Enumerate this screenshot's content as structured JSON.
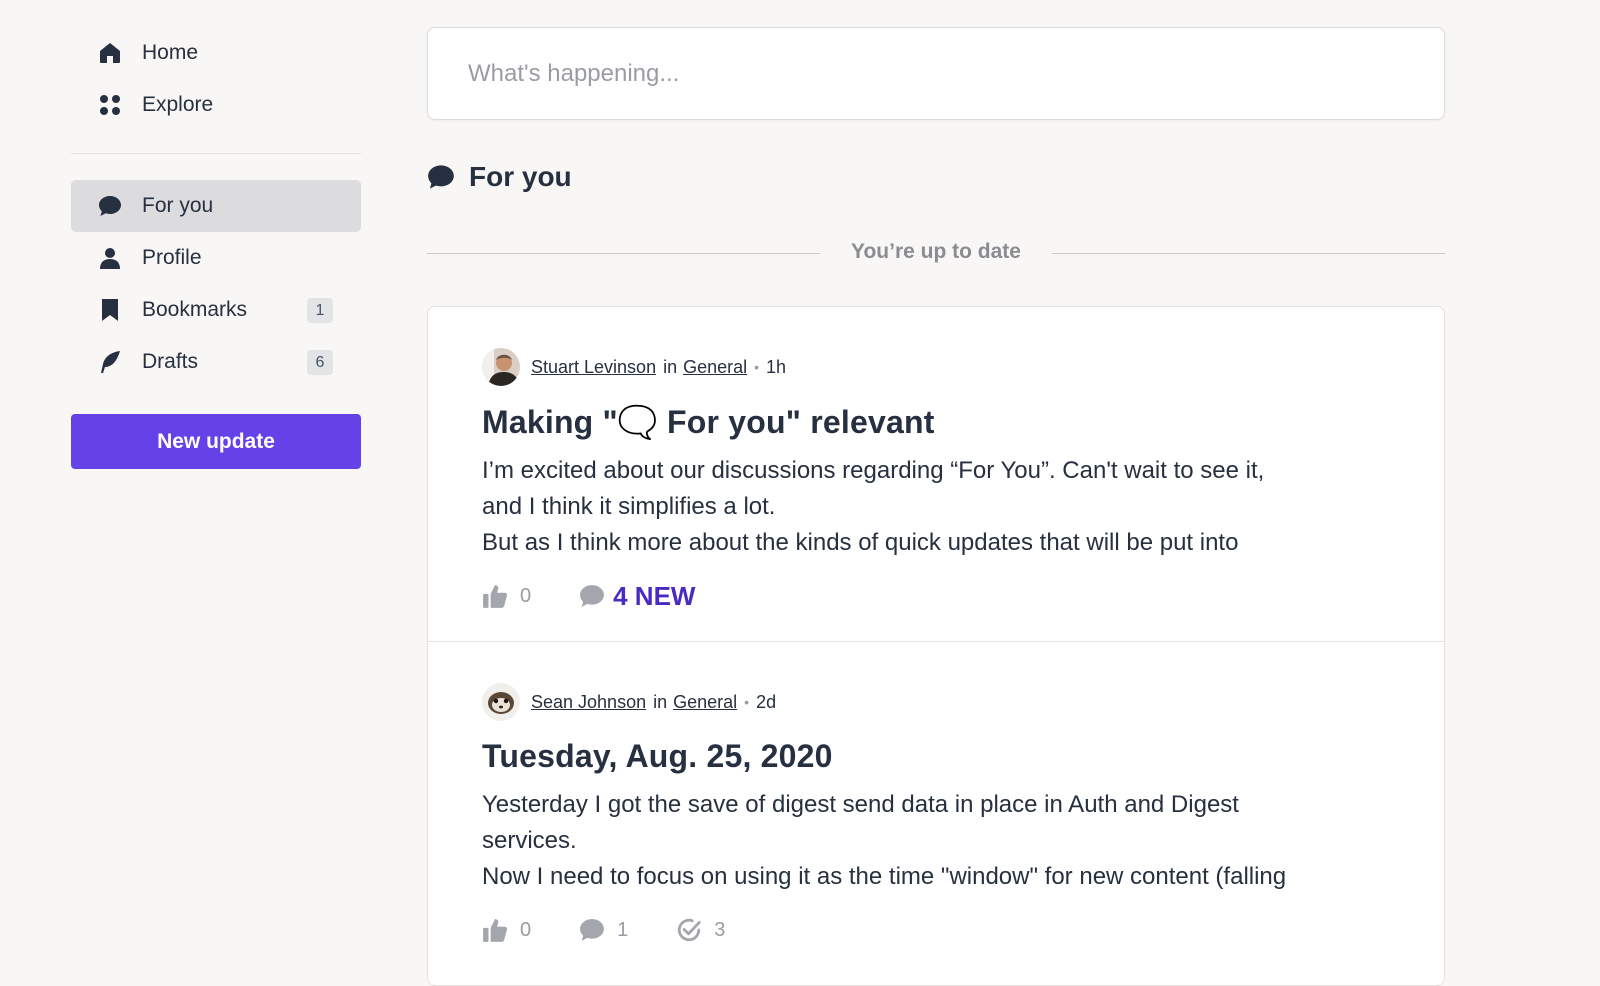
{
  "sidebar": {
    "top_items": [
      {
        "label": "Home",
        "icon": "home-icon"
      },
      {
        "label": "Explore",
        "icon": "explore-grid-icon"
      }
    ],
    "items": [
      {
        "label": "For you",
        "icon": "speech-bubble-icon",
        "active": true
      },
      {
        "label": "Profile",
        "icon": "person-icon"
      },
      {
        "label": "Bookmarks",
        "icon": "bookmark-icon",
        "badge": "1"
      },
      {
        "label": "Drafts",
        "icon": "quill-icon",
        "badge": "6"
      }
    ],
    "new_update_label": "New update"
  },
  "composer": {
    "placeholder": "What's happening..."
  },
  "feed": {
    "title": "For you",
    "status": "You’re up to date",
    "posts": [
      {
        "author": "Stuart Levinson",
        "in_label": "in",
        "group": "General",
        "time": "1h",
        "title": "Making \"🗨️ For you\" relevant",
        "body_lines": [
          "I’m excited about our discussions regarding “For You”. Can't wait to see it,",
          "and I think it simplifies a lot.",
          "But as I think more about the kinds of quick updates that will be put into"
        ],
        "likes": "0",
        "comments_new": "4 NEW"
      },
      {
        "author": "Sean Johnson",
        "in_label": "in",
        "group": "General",
        "time": "2d",
        "title": "Tuesday, Aug. 25, 2020",
        "body_lines": [
          "Yesterday I got the save of digest send data in place in Auth and Digest",
          "services.",
          "Now I need to focus on using it as the time \"window\" for new content (falling"
        ],
        "likes": "0",
        "comments": "1",
        "seen": "3"
      }
    ]
  },
  "colors": {
    "accent": "#6541e8",
    "new_comments": "#4a2bc2",
    "background": "#f8f7f5",
    "text": "#263040"
  }
}
